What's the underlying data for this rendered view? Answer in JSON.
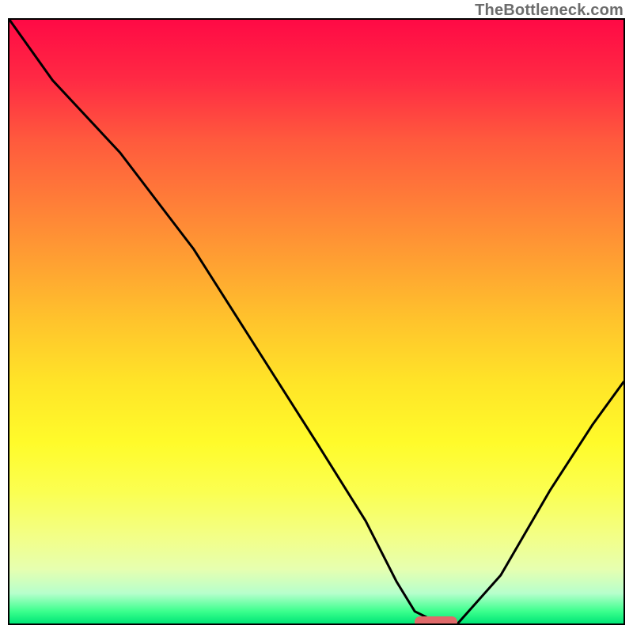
{
  "watermark": "TheBottleneck.com",
  "colors": {
    "border": "#000000",
    "curve": "#000000",
    "marker": "#e06a6a",
    "gradient_top": "#ff0a45",
    "gradient_bottom": "#00e676"
  },
  "chart_data": {
    "type": "line",
    "title": "",
    "xlabel": "",
    "ylabel": "",
    "xlim": [
      0,
      100
    ],
    "ylim": [
      0,
      100
    ],
    "series": [
      {
        "name": "bottleneck-curve",
        "x": [
          0,
          7,
          18,
          24,
          30,
          40,
          50,
          58,
          63,
          66,
          70,
          73,
          80,
          88,
          95,
          100
        ],
        "values": [
          100,
          90,
          78,
          70,
          62,
          46,
          30,
          17,
          7,
          2,
          0,
          0,
          8,
          22,
          33,
          40
        ]
      }
    ],
    "marker": {
      "x_start": 66,
      "x_end": 73,
      "y": 0
    }
  }
}
